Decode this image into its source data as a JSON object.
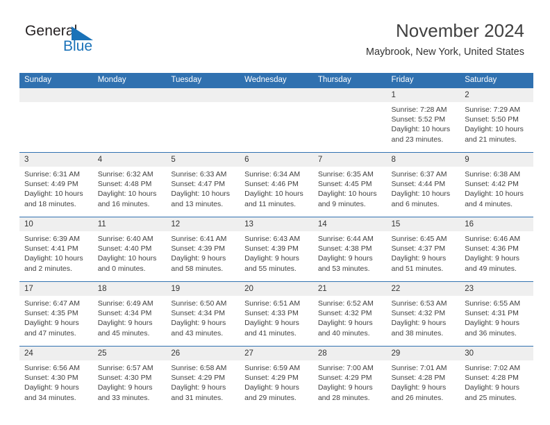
{
  "brand": {
    "text_general": "General",
    "text_blue": "Blue",
    "triangle_color": "#1a72b8"
  },
  "header": {
    "title": "November 2024",
    "subtitle": "Maybrook, New York, United States",
    "accent_color": "#3071b0",
    "daynum_band_color": "#efefef"
  },
  "calendar": {
    "weekdays": [
      "Sunday",
      "Monday",
      "Tuesday",
      "Wednesday",
      "Thursday",
      "Friday",
      "Saturday"
    ],
    "weeks": [
      [
        {
          "day": "",
          "empty": true
        },
        {
          "day": "",
          "empty": true
        },
        {
          "day": "",
          "empty": true
        },
        {
          "day": "",
          "empty": true
        },
        {
          "day": "",
          "empty": true
        },
        {
          "day": "1",
          "sunrise": "Sunrise: 7:28 AM",
          "sunset": "Sunset: 5:52 PM",
          "daylight1": "Daylight: 10 hours",
          "daylight2": "and 23 minutes."
        },
        {
          "day": "2",
          "sunrise": "Sunrise: 7:29 AM",
          "sunset": "Sunset: 5:50 PM",
          "daylight1": "Daylight: 10 hours",
          "daylight2": "and 21 minutes."
        }
      ],
      [
        {
          "day": "3",
          "sunrise": "Sunrise: 6:31 AM",
          "sunset": "Sunset: 4:49 PM",
          "daylight1": "Daylight: 10 hours",
          "daylight2": "and 18 minutes."
        },
        {
          "day": "4",
          "sunrise": "Sunrise: 6:32 AM",
          "sunset": "Sunset: 4:48 PM",
          "daylight1": "Daylight: 10 hours",
          "daylight2": "and 16 minutes."
        },
        {
          "day": "5",
          "sunrise": "Sunrise: 6:33 AM",
          "sunset": "Sunset: 4:47 PM",
          "daylight1": "Daylight: 10 hours",
          "daylight2": "and 13 minutes."
        },
        {
          "day": "6",
          "sunrise": "Sunrise: 6:34 AM",
          "sunset": "Sunset: 4:46 PM",
          "daylight1": "Daylight: 10 hours",
          "daylight2": "and 11 minutes."
        },
        {
          "day": "7",
          "sunrise": "Sunrise: 6:35 AM",
          "sunset": "Sunset: 4:45 PM",
          "daylight1": "Daylight: 10 hours",
          "daylight2": "and 9 minutes."
        },
        {
          "day": "8",
          "sunrise": "Sunrise: 6:37 AM",
          "sunset": "Sunset: 4:44 PM",
          "daylight1": "Daylight: 10 hours",
          "daylight2": "and 6 minutes."
        },
        {
          "day": "9",
          "sunrise": "Sunrise: 6:38 AM",
          "sunset": "Sunset: 4:42 PM",
          "daylight1": "Daylight: 10 hours",
          "daylight2": "and 4 minutes."
        }
      ],
      [
        {
          "day": "10",
          "sunrise": "Sunrise: 6:39 AM",
          "sunset": "Sunset: 4:41 PM",
          "daylight1": "Daylight: 10 hours",
          "daylight2": "and 2 minutes."
        },
        {
          "day": "11",
          "sunrise": "Sunrise: 6:40 AM",
          "sunset": "Sunset: 4:40 PM",
          "daylight1": "Daylight: 10 hours",
          "daylight2": "and 0 minutes."
        },
        {
          "day": "12",
          "sunrise": "Sunrise: 6:41 AM",
          "sunset": "Sunset: 4:39 PM",
          "daylight1": "Daylight: 9 hours",
          "daylight2": "and 58 minutes."
        },
        {
          "day": "13",
          "sunrise": "Sunrise: 6:43 AM",
          "sunset": "Sunset: 4:39 PM",
          "daylight1": "Daylight: 9 hours",
          "daylight2": "and 55 minutes."
        },
        {
          "day": "14",
          "sunrise": "Sunrise: 6:44 AM",
          "sunset": "Sunset: 4:38 PM",
          "daylight1": "Daylight: 9 hours",
          "daylight2": "and 53 minutes."
        },
        {
          "day": "15",
          "sunrise": "Sunrise: 6:45 AM",
          "sunset": "Sunset: 4:37 PM",
          "daylight1": "Daylight: 9 hours",
          "daylight2": "and 51 minutes."
        },
        {
          "day": "16",
          "sunrise": "Sunrise: 6:46 AM",
          "sunset": "Sunset: 4:36 PM",
          "daylight1": "Daylight: 9 hours",
          "daylight2": "and 49 minutes."
        }
      ],
      [
        {
          "day": "17",
          "sunrise": "Sunrise: 6:47 AM",
          "sunset": "Sunset: 4:35 PM",
          "daylight1": "Daylight: 9 hours",
          "daylight2": "and 47 minutes."
        },
        {
          "day": "18",
          "sunrise": "Sunrise: 6:49 AM",
          "sunset": "Sunset: 4:34 PM",
          "daylight1": "Daylight: 9 hours",
          "daylight2": "and 45 minutes."
        },
        {
          "day": "19",
          "sunrise": "Sunrise: 6:50 AM",
          "sunset": "Sunset: 4:34 PM",
          "daylight1": "Daylight: 9 hours",
          "daylight2": "and 43 minutes."
        },
        {
          "day": "20",
          "sunrise": "Sunrise: 6:51 AM",
          "sunset": "Sunset: 4:33 PM",
          "daylight1": "Daylight: 9 hours",
          "daylight2": "and 41 minutes."
        },
        {
          "day": "21",
          "sunrise": "Sunrise: 6:52 AM",
          "sunset": "Sunset: 4:32 PM",
          "daylight1": "Daylight: 9 hours",
          "daylight2": "and 40 minutes."
        },
        {
          "day": "22",
          "sunrise": "Sunrise: 6:53 AM",
          "sunset": "Sunset: 4:32 PM",
          "daylight1": "Daylight: 9 hours",
          "daylight2": "and 38 minutes."
        },
        {
          "day": "23",
          "sunrise": "Sunrise: 6:55 AM",
          "sunset": "Sunset: 4:31 PM",
          "daylight1": "Daylight: 9 hours",
          "daylight2": "and 36 minutes."
        }
      ],
      [
        {
          "day": "24",
          "sunrise": "Sunrise: 6:56 AM",
          "sunset": "Sunset: 4:30 PM",
          "daylight1": "Daylight: 9 hours",
          "daylight2": "and 34 minutes."
        },
        {
          "day": "25",
          "sunrise": "Sunrise: 6:57 AM",
          "sunset": "Sunset: 4:30 PM",
          "daylight1": "Daylight: 9 hours",
          "daylight2": "and 33 minutes."
        },
        {
          "day": "26",
          "sunrise": "Sunrise: 6:58 AM",
          "sunset": "Sunset: 4:29 PM",
          "daylight1": "Daylight: 9 hours",
          "daylight2": "and 31 minutes."
        },
        {
          "day": "27",
          "sunrise": "Sunrise: 6:59 AM",
          "sunset": "Sunset: 4:29 PM",
          "daylight1": "Daylight: 9 hours",
          "daylight2": "and 29 minutes."
        },
        {
          "day": "28",
          "sunrise": "Sunrise: 7:00 AM",
          "sunset": "Sunset: 4:29 PM",
          "daylight1": "Daylight: 9 hours",
          "daylight2": "and 28 minutes."
        },
        {
          "day": "29",
          "sunrise": "Sunrise: 7:01 AM",
          "sunset": "Sunset: 4:28 PM",
          "daylight1": "Daylight: 9 hours",
          "daylight2": "and 26 minutes."
        },
        {
          "day": "30",
          "sunrise": "Sunrise: 7:02 AM",
          "sunset": "Sunset: 4:28 PM",
          "daylight1": "Daylight: 9 hours",
          "daylight2": "and 25 minutes."
        }
      ]
    ]
  }
}
